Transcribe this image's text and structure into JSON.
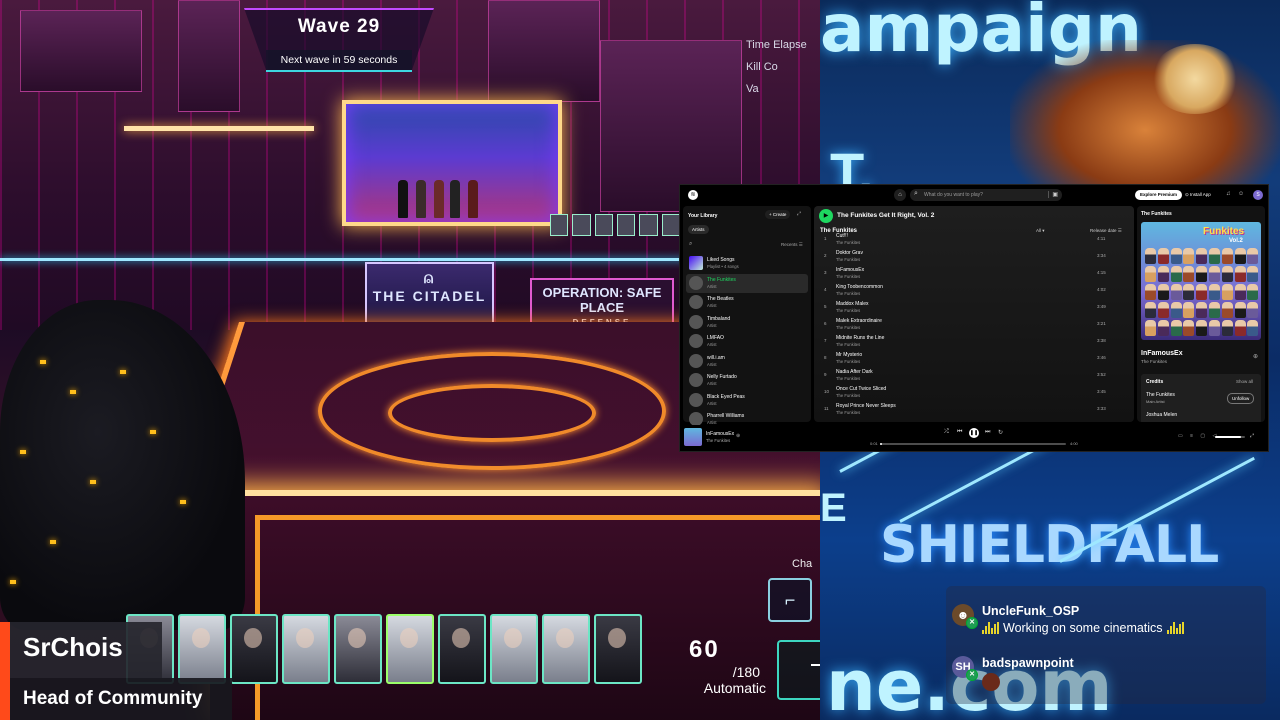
{
  "game": {
    "wave_title": "Wave 29",
    "wave_subtitle": "Next wave in 59 seconds",
    "stats": [
      "Time Elapse",
      "Kill Co",
      "Va"
    ],
    "signs": {
      "citadel": "THE CITADEL",
      "osp": "OPERATION: SAFE PLACE",
      "osp_sub": "DEFENSE"
    },
    "ammo_count": "60",
    "ammo_max": "/180",
    "fire_mode": "Automatic",
    "weapon_label": "Cha",
    "weapon_icon": "pistol-icon",
    "card_count": 10
  },
  "streamer": {
    "name": "SrChois",
    "role": "Head of Community",
    "accent_color": "#ff4a1a"
  },
  "background": {
    "word1": "ampaign",
    "word2": "T.",
    "word3": "SHIELDFALL",
    "word4": "ne.com",
    "word5": "E"
  },
  "chat": [
    {
      "user": "UncleFunk_OSP",
      "message": "Working on some cinematics",
      "avatar": "avatar-icon"
    },
    {
      "user": "badspawnpoint",
      "message": "",
      "avatar_text": "SH"
    }
  ],
  "spotify": {
    "search_placeholder": "What do you want to play?",
    "explore_premium": "Explore Premium",
    "install_app": "Install App",
    "avatar_letter": "S",
    "library": {
      "title": "Your Library",
      "create": "+ Create",
      "filter_chip": "Artists",
      "sort": "Recents",
      "items": [
        {
          "name": "Liked Songs",
          "sub": "Playlist • 4 songs",
          "square": true
        },
        {
          "name": "The Funkites",
          "sub": "Artist",
          "active": true
        },
        {
          "name": "The Beatles",
          "sub": "Artist"
        },
        {
          "name": "Timbaland",
          "sub": "Artist"
        },
        {
          "name": "LMFAO",
          "sub": "Artist"
        },
        {
          "name": "will.i.am",
          "sub": "Artist"
        },
        {
          "name": "Nelly Furtado",
          "sub": "Artist"
        },
        {
          "name": "Black Eyed Peas",
          "sub": "Artist"
        },
        {
          "name": "Pharrell Williams",
          "sub": "Artist"
        }
      ]
    },
    "album_title": "The Funkites Get It Right, Vol. 2",
    "artist_heading": "The Funkites",
    "filter_label": "All",
    "sort_label": "Release date",
    "tracks": [
      {
        "num": "1",
        "title": "Cut!!!",
        "artist": "The Funkites",
        "dur": "4:11"
      },
      {
        "num": "2",
        "title": "Doktor Grav",
        "artist": "The Funkites",
        "dur": "3:34"
      },
      {
        "num": "3",
        "title": "InFamousEx",
        "artist": "The Funkites",
        "dur": "4:15"
      },
      {
        "num": "4",
        "title": "King Toobencommon",
        "artist": "The Funkites",
        "dur": "4:02"
      },
      {
        "num": "5",
        "title": "Maddox Malex",
        "artist": "The Funkites",
        "dur": "3:49"
      },
      {
        "num": "6",
        "title": "Malek Extraordinaire",
        "artist": "The Funkites",
        "dur": "3:21"
      },
      {
        "num": "7",
        "title": "Midnite Runs the Line",
        "artist": "The Funkites",
        "dur": "3:38"
      },
      {
        "num": "8",
        "title": "Mr Mysterio",
        "artist": "The Funkites",
        "dur": "3:46"
      },
      {
        "num": "9",
        "title": "Nadia After Dark",
        "artist": "The Funkites",
        "dur": "3:52"
      },
      {
        "num": "10",
        "title": "Once Cut Twice Sliced",
        "artist": "The Funkites",
        "dur": "3:45"
      },
      {
        "num": "11",
        "title": "Royal Prince Never Sleeps",
        "artist": "The Funkites",
        "dur": "3:33"
      }
    ],
    "side": {
      "heading": "The Funkites",
      "cover_title": "Funkites",
      "cover_sub": "Vol.2",
      "track_name": "InFamousEx",
      "track_artist": "The Funkites",
      "credits_heading": "Credits",
      "show_all": "Show all",
      "credit1": "The Funkites",
      "credit1_role": "Main Artist",
      "unfollow": "Unfollow",
      "credit2": "Joshua Melen"
    },
    "now_playing": {
      "title": "InFamousEx",
      "artist": "The Funkites",
      "elapsed": "0:01",
      "total": "4:00",
      "progress": 0.01,
      "volume": 0.85
    },
    "accent": "#1ed760"
  }
}
